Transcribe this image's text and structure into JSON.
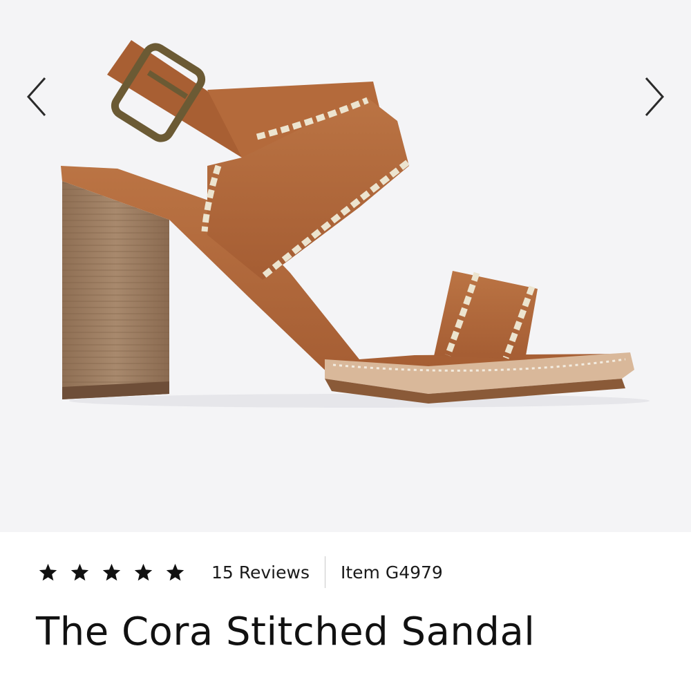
{
  "gallery": {
    "prev_icon": "chevron-left-icon",
    "next_icon": "chevron-right-icon",
    "colors": {
      "background": "#f4f4f6",
      "leather": "#b0673a",
      "stitching": "#ece4cf",
      "heel": "#9a7a5e"
    }
  },
  "product": {
    "rating": 5,
    "rating_max": 5,
    "star_icon": "star-icon",
    "reviews_label": "15 Reviews",
    "item_label": "Item G4979",
    "title": "The Cora Stitched Sandal"
  }
}
